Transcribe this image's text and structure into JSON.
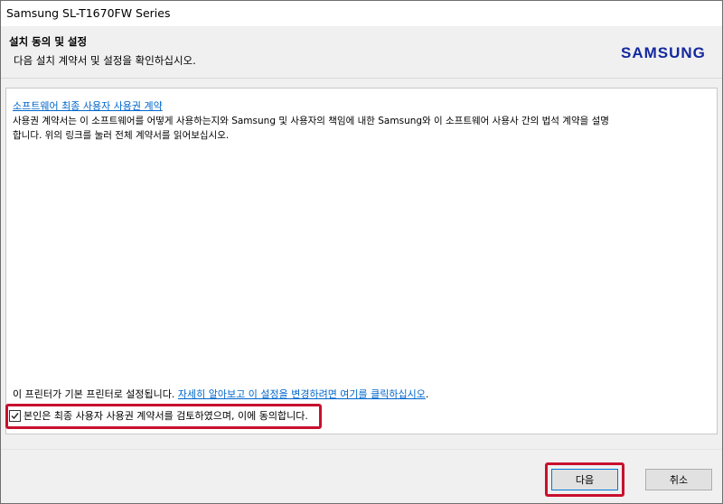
{
  "window": {
    "title": "Samsung SL-T1670FW Series"
  },
  "header": {
    "title": "설치 동의 및 설정",
    "subtitle": "다음 설치 계약서 및 설정을 확인하십시오.",
    "logo_text": "SAMSUNG",
    "logo_color": "#1428a0"
  },
  "license": {
    "link_text": "소프트웨어 최종 사용자 사용권 계약",
    "description": "사용권 계약서는 이 소프트웨어를 어떻게 사용하는지와 Samsung 및 사용자의 책임에 내한 Samsung와 이 소프트웨어 사용사 간의 법석 계약을 설명합니다. 위의 링크를 눌러 전체 계약서를 읽어보십시오."
  },
  "printer": {
    "text": "이 프린터가 기본 프린터로 설정됩니다.",
    "link_text": "자세히 알아보고 이 설정을 변경하려면 여기를 클릭하십시오",
    "suffix": "."
  },
  "agreement": {
    "checked": true,
    "label": "본인은 최종 사용자 사용권 계약서를 검토하였으며, 이에 동의합니다."
  },
  "buttons": {
    "next": "다음",
    "cancel": "취소"
  },
  "colors": {
    "highlight": "#c8102e",
    "link": "#0066cc"
  }
}
